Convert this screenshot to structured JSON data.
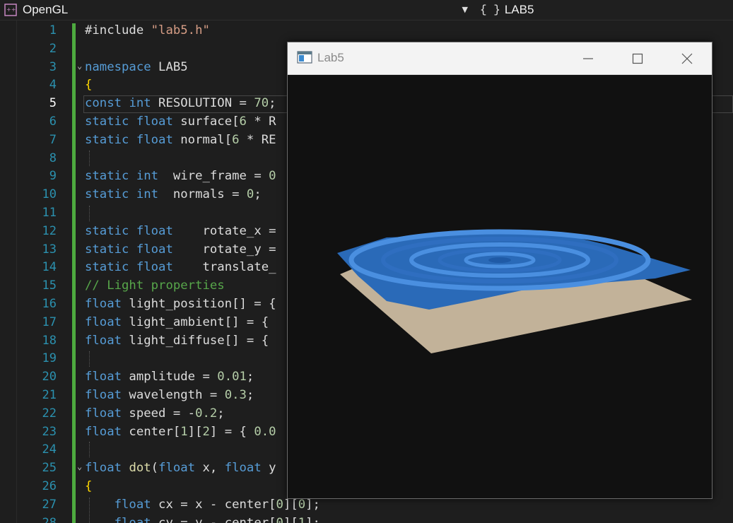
{
  "navbar": {
    "project": "OpenGL",
    "project_icon": "cpp-project-icon",
    "scope_icon": "{ }",
    "scope": "LAB5"
  },
  "editor": {
    "current_line": 5,
    "line_numbers": [
      "1",
      "2",
      "3",
      "4",
      "5",
      "6",
      "7",
      "8",
      "9",
      "10",
      "11",
      "12",
      "13",
      "14",
      "15",
      "16",
      "17",
      "18",
      "19",
      "20",
      "21",
      "22",
      "23",
      "24",
      "25",
      "26",
      "27",
      "28"
    ],
    "lines": [
      "#include \"lab5.h\"",
      "",
      "namespace LAB5",
      "{",
      "const int RESOLUTION = 70;",
      "static float surface[6 * R",
      "static float normal[6 * RE",
      "",
      "static int  wire_frame = 0",
      "static int  normals = 0;",
      "",
      "static float    rotate_x =",
      "static float    rotate_y =",
      "static float    translate_",
      "// Light properties",
      "float light_position[] = {",
      "float light_ambient[] = {",
      "float light_diffuse[] = {",
      "",
      "float amplitude = 0.01;",
      "float wavelength = 0.3;",
      "float speed = -0.2;",
      "float center[1][2] = { 0.0",
      "",
      "float dot(float x, float y",
      "{",
      "    float cx = x - center[0][0];",
      "    float cy = y - center[0][1];"
    ],
    "colors": {
      "keyword": "#569cd6",
      "string": "#d69d85",
      "number": "#b5cea8",
      "comment": "#57a64a",
      "brace": "#ffd700",
      "change_bar": "#4daa3f"
    }
  },
  "window": {
    "title": "Lab5",
    "minimize_icon": "minimize-icon",
    "maximize_icon": "maximize-icon",
    "close_icon": "close-icon",
    "colors": {
      "water": "#3f7fcf",
      "floor": "#c2b299",
      "background": "#111111"
    }
  }
}
